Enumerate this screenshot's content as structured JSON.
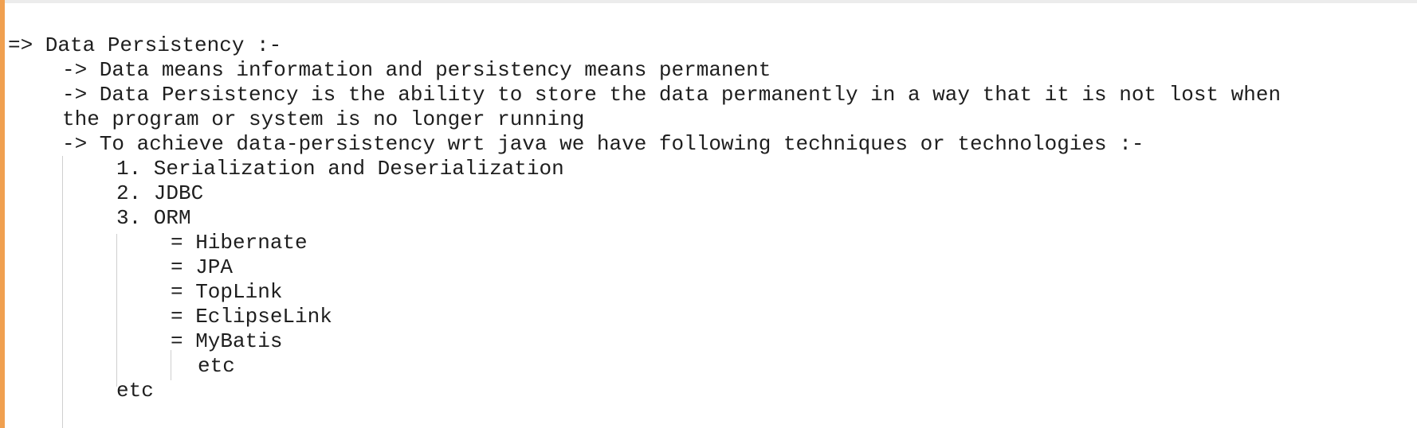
{
  "editor": {
    "lines": [
      {
        "text": "=> Data Persistency :-"
      },
      {
        "text": "-> Data means information and persistency means permanent"
      },
      {
        "text": "-> Data Persistency is the ability to store the data permanently in a way that it is not lost when"
      },
      {
        "text": "the program or system is no longer running"
      },
      {
        "text": "-> To achieve data-persistency wrt java we have following techniques or technologies :-"
      },
      {
        "text": "1. Serialization and Deserialization"
      },
      {
        "text": "2. JDBC"
      },
      {
        "text": "3. ORM"
      },
      {
        "text": "= Hibernate"
      },
      {
        "text": "= JPA"
      },
      {
        "text": "= TopLink"
      },
      {
        "text": "= EclipseLink"
      },
      {
        "text": "= MyBatis"
      },
      {
        "text": "etc"
      },
      {
        "text": "etc"
      }
    ]
  },
  "colors": {
    "text": "#1e1e1e",
    "left_border": "#f0a050",
    "indent_guide": "#cfcfcf",
    "background": "#ffffff"
  }
}
